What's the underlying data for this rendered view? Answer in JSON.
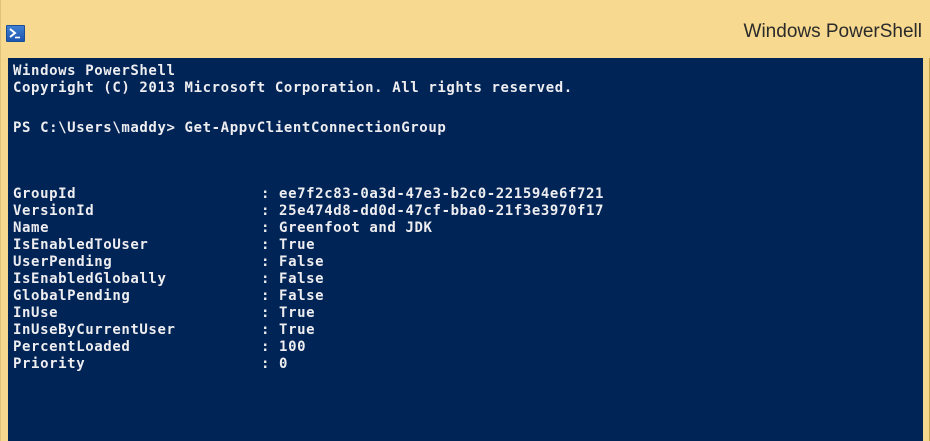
{
  "window": {
    "title": "Windows PowerShell",
    "icon": "powershell-icon",
    "colors": {
      "titlebar": "#f7d98f",
      "console_background": "#012456",
      "console_text": "#eeedf0"
    }
  },
  "console": {
    "banner_line1": "Windows PowerShell",
    "banner_line2": "Copyright (C) 2013 Microsoft Corporation. All rights reserved.",
    "prompt": "PS C:\\Users\\maddy> Get-AppvClientConnectionGroup",
    "properties": [
      {
        "name": "GroupId",
        "value": ": ee7f2c83-0a3d-47e3-b2c0-221594e6f721"
      },
      {
        "name": "VersionId",
        "value": ": 25e474d8-dd0d-47cf-bba0-21f3e3970f17"
      },
      {
        "name": "Name",
        "value": ": Greenfoot and JDK"
      },
      {
        "name": "IsEnabledToUser",
        "value": ": True"
      },
      {
        "name": "UserPending",
        "value": ": False"
      },
      {
        "name": "IsEnabledGlobally",
        "value": ": False"
      },
      {
        "name": "GlobalPending",
        "value": ": False"
      },
      {
        "name": "InUse",
        "value": ": True"
      },
      {
        "name": "InUseByCurrentUser",
        "value": ": True"
      },
      {
        "name": "PercentLoaded",
        "value": ": 100"
      },
      {
        "name": "Priority",
        "value": ": 0"
      }
    ]
  }
}
